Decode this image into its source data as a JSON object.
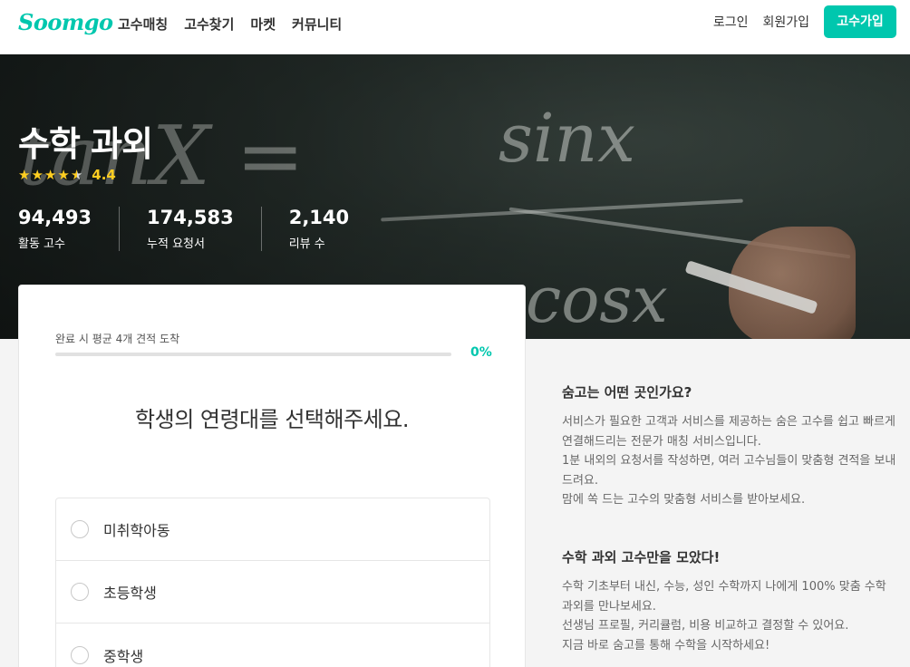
{
  "header": {
    "logo": "Soomgo",
    "nav": [
      "고수매칭",
      "고수찾기",
      "마켓",
      "커뮤니티"
    ],
    "login": "로그인",
    "register": "회원가입",
    "pro_signup": "고수가입"
  },
  "hero": {
    "title": "수학 과외",
    "rating": "4.4",
    "rating_fraction": 0.88,
    "chalk": [
      "tanX =",
      "sinx",
      "cosx"
    ],
    "stats": [
      {
        "value": "94,493",
        "label": "활동 고수"
      },
      {
        "value": "174,583",
        "label": "누적 요청서"
      },
      {
        "value": "2,140",
        "label": "리뷰 수"
      }
    ]
  },
  "form": {
    "progress_label": "완료 시 평균 4개 견적 도착",
    "progress_percent": "0%",
    "progress_value": 0,
    "question": "학생의 연령대를 선택해주세요.",
    "options": [
      "미취학아동",
      "초등학생",
      "중학생"
    ]
  },
  "info": [
    {
      "title": "숨고는 어떤 곳인가요?",
      "lines": [
        "서비스가 필요한 고객과 서비스를 제공하는 숨은 고수를 쉽고 빠르게 연결해드리는 전문가 매칭 서비스입니다.",
        "1분 내외의 요청서를 작성하면, 여러 고수님들이 맞춤형 견적을 보내드려요.",
        "맘에 쏙 드는 고수의 맞춤형 서비스를 받아보세요."
      ]
    },
    {
      "title": "수학 과외 고수만을 모았다!",
      "lines": [
        "수학 기초부터 내신, 수능, 성인 수학까지 나에게 100% 맞춤 수학 과외를 만나보세요.",
        "선생님 프로필, 커리큘럼, 비용 비교하고 결정할 수 있어요.",
        "지금 바로 숨고를 통해 수학을 시작하세요!"
      ]
    }
  ],
  "colors": {
    "brand": "#00c7ae",
    "star": "#ffce21"
  }
}
